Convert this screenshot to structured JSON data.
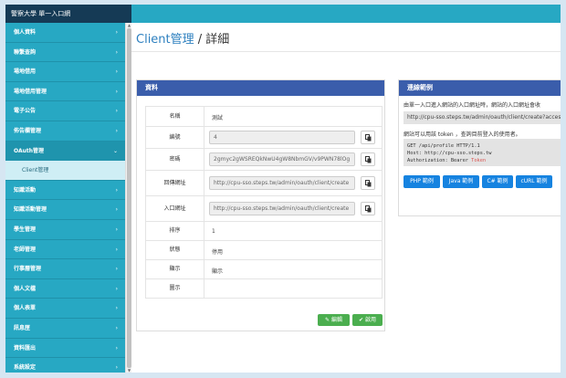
{
  "app": {
    "brand": "警察大學 單一入口網"
  },
  "sidebar": {
    "items": [
      {
        "label": "個人資料",
        "chev": "›"
      },
      {
        "label": "聯繫查詢",
        "chev": "›"
      },
      {
        "label": "場地借用",
        "chev": "›"
      },
      {
        "label": "場地借用管理",
        "chev": "›"
      },
      {
        "label": "電子公告",
        "chev": "›"
      },
      {
        "label": "佈告欄管理",
        "chev": "›"
      },
      {
        "label": "OAuth管理",
        "chev": "⌄"
      },
      {
        "label": "Client管理",
        "chev": ""
      },
      {
        "label": "知識活動",
        "chev": "›"
      },
      {
        "label": "知識活動管理",
        "chev": "›"
      },
      {
        "label": "學生管理",
        "chev": "›"
      },
      {
        "label": "老師管理",
        "chev": "›"
      },
      {
        "label": "行事曆管理",
        "chev": "›"
      },
      {
        "label": "個人文檔",
        "chev": "›"
      },
      {
        "label": "個人表單",
        "chev": "›"
      },
      {
        "label": "訊息匣",
        "chev": "›"
      },
      {
        "label": "資料匯出",
        "chev": "›"
      },
      {
        "label": "系統設定",
        "chev": "›"
      }
    ]
  },
  "page": {
    "title_part1": "Client管理",
    "title_sep": " / ",
    "title_part2": "詳細"
  },
  "data_panel": {
    "title": "資料",
    "rows": {
      "name": {
        "label": "名稱",
        "value": "測試"
      },
      "id": {
        "label": "編號",
        "value": "4"
      },
      "secret": {
        "label": "密碼",
        "value": "2gmyc2gWSREQkNwU4gW8NbmGV/v9PWN78lOg"
      },
      "callback": {
        "label": "回傳網址",
        "value": "http://cpu-sso.steps.tw/admin/oauth/client/create"
      },
      "entry": {
        "label": "入口網址",
        "value": "http://cpu-sso.steps.tw/admin/oauth/client/create"
      },
      "order": {
        "label": "排序",
        "value": "1"
      },
      "status": {
        "label": "狀態",
        "value": "停用"
      },
      "display": {
        "label": "顯示",
        "value": "顯示"
      },
      "icon": {
        "label": "圖示",
        "value": ""
      }
    },
    "edit_label": "編輯",
    "enable_label": "啟用"
  },
  "example_panel": {
    "title": "連線範例",
    "desc1": "由單一入口進入網站的入口網址時，網站的入口網址會收",
    "url": "http://cpu-sso.steps.tw/admin/oauth/client/create?access",
    "desc2": "網站可以用該 token ，查詢目前登入的使用者。",
    "code": [
      "GET /api/profile HTTP/1.1",
      "Host: http://cpu-sso.steps.tw",
      "Authorization: Bearer "
    ],
    "token_word": "Token",
    "buttons": [
      "PHP 範例",
      "Java 範例",
      "C# 範例",
      "cURL 範例"
    ]
  },
  "colors": {
    "topbar": "#27a8c3",
    "brand_bg": "#153a55",
    "panel_header": "#3a5dab",
    "status_disabled": "#d9534f",
    "status_shown": "#3c9b3c",
    "btn_green": "#4bae4f",
    "btn_blue": "#1683e0"
  }
}
